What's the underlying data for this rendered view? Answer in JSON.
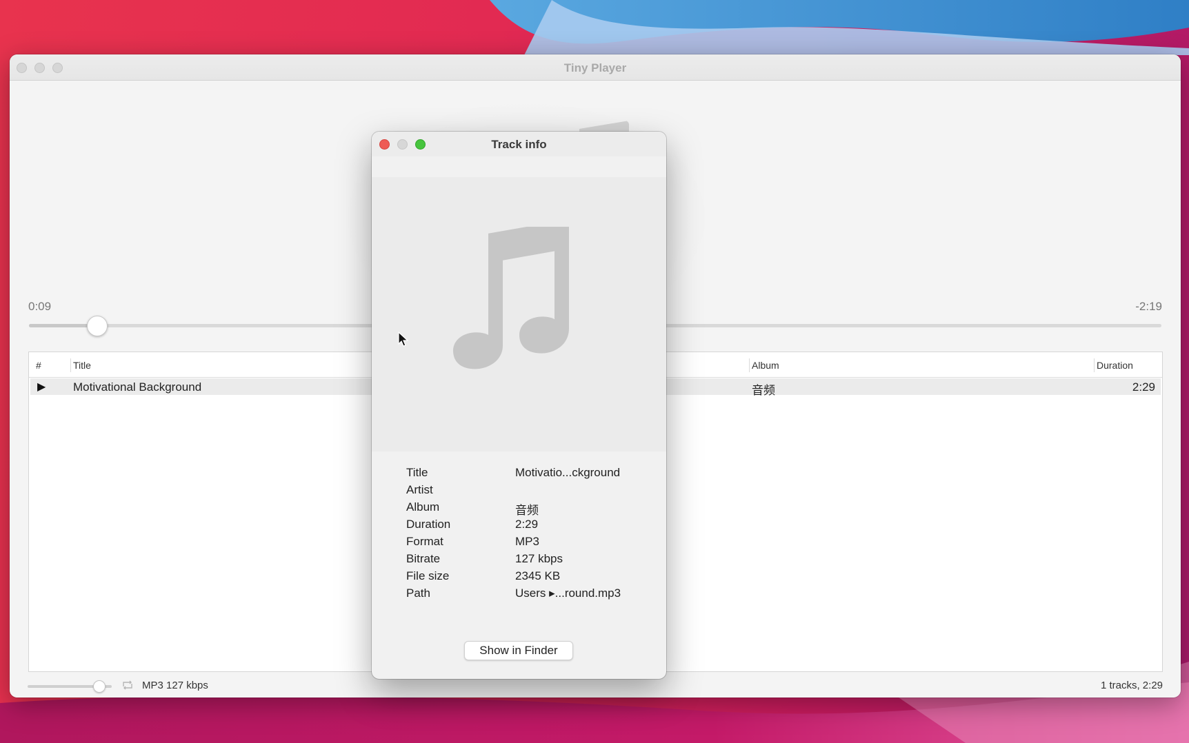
{
  "main_window": {
    "title": "Tiny Player",
    "playback": {
      "elapsed": "0:09",
      "remaining": "-2:19",
      "progress_fraction": 0.06
    },
    "table": {
      "columns": [
        "#",
        "Title",
        "Album",
        "Duration"
      ],
      "rows": [
        {
          "title": "Motivational Background",
          "album": "音频",
          "duration": "2:29",
          "playing": true
        }
      ]
    },
    "status": {
      "volume_fraction": 0.85,
      "format": "MP3 127 kbps",
      "summary": "1 tracks, 2:29"
    }
  },
  "dialog": {
    "title": "Track info",
    "fields": [
      {
        "label": "Title",
        "value": "Motivatio...ckground"
      },
      {
        "label": "Artist",
        "value": ""
      },
      {
        "label": "Album",
        "value": "音频"
      },
      {
        "label": "Duration",
        "value": "2:29"
      },
      {
        "label": "Format",
        "value": "MP3"
      },
      {
        "label": "Bitrate",
        "value": "127 kbps"
      },
      {
        "label": "File size",
        "value": "2345 KB"
      },
      {
        "label": "Path",
        "value": "Users ▸...round.mp3"
      }
    ],
    "show_in_finder_label": "Show in Finder"
  },
  "icons": {
    "artwork": "music-note-icon",
    "play": "play-icon",
    "repeat": "repeat-icon",
    "cursor": "mouse-pointer-icon"
  },
  "colors": {
    "close": "#ee5b55",
    "zoom": "#47c43d",
    "artwork_note": "#c6c6c6"
  }
}
